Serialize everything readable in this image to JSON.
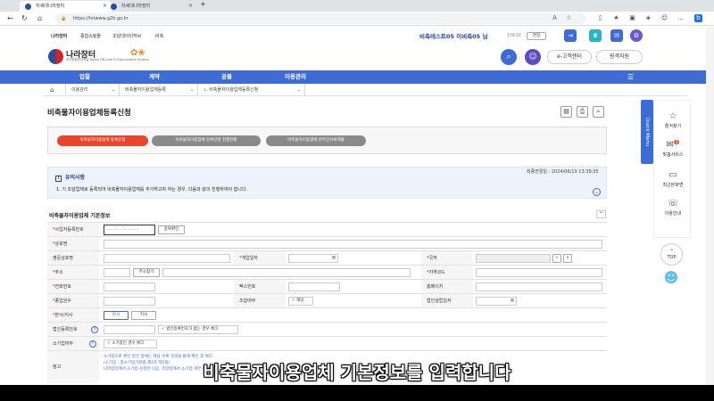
{
  "browser": {
    "tabs": [
      {
        "label": "지세대나라장터"
      },
      {
        "label": "차세대나라장터"
      }
    ],
    "url": "https://tstwww.g2b.go.kr"
  },
  "util_links": [
    "나라장터",
    "종합쇼핑몰",
    "조달데이터허브",
    "비축"
  ],
  "user": {
    "name": "비축테스트05 이비축05 님",
    "timer": "179:57",
    "extend": "연장"
  },
  "logo": {
    "text": "나라장터",
    "sub": "국가종합전자조달 Korea ON-Line E-Procurement System"
  },
  "header_buttons": {
    "customer": "e-고객센터",
    "remote": "원격지원"
  },
  "main_nav": [
    "입찰",
    "계약",
    "공통",
    "이용관리"
  ],
  "breadcrumb": [
    "이용관리",
    "비축물자이용업체등록",
    "ㄴ 비축물자이용업체등록신청"
  ],
  "page": {
    "title": "비축물자이용업체등록신청"
  },
  "steps": [
    "비축물자이용업체 등록신청",
    "비축물자이용업체 등록신청 진행현황",
    "비축물자이용업체 온라인서류제출"
  ],
  "notice": {
    "title": "유의사항",
    "text": "1. 기 조달업체로 등록되어 비축물자이용업체를 추가하고자 하는 경우, 다음과 같이 진행하여야 합니다.",
    "date": "최종변경일 : 2024/06/19 13:39:55"
  },
  "section": {
    "title": "비축물자이용업체 기본정보"
  },
  "form": {
    "biz_no": "사업자등록번호",
    "dup_check": "중복확인",
    "company": "상호명",
    "company_en": "영문상호명",
    "open_date": "개업일자",
    "country": "국적",
    "address": "주소",
    "addr_search": "주소찾기",
    "area_code": "지역코드",
    "phone": "전화번호",
    "fax": "팩스번호",
    "homepage": "홈페이지",
    "employees": "종업원수",
    "union": "조합여부",
    "union_opt": "해당",
    "corp_date": "법인설립일자",
    "hq": "본사/지사",
    "hq_opt": "본사",
    "branch_opt": "지사",
    "corp_no": "법인등록번호",
    "no_corp": "법인등록번호가 없는 경우 체크",
    "small": "소기업여부",
    "small_opt": "소기업인 경우 체크",
    "ref": "참고",
    "ref_text1": "소기업으로 확인 받은 업체는 해당 목록 검색을 통해 확인 후 체크",
    "ref_text2": "(소기업 : 중소기업기본법 제2조 제2항)",
    "ref_text3": "나라장터에서 소기업 신청한 다음, 조달청에서 소기업 여부 확인"
  },
  "side": {
    "quick": "Quick Menu",
    "items": [
      {
        "label": "즐겨찾기"
      },
      {
        "label": "맞춤서비스",
        "badge": "0"
      },
      {
        "label": "최근본화면"
      },
      {
        "label": "이용안내"
      }
    ],
    "top": "TOP"
  },
  "caption": "비축물자이용업체 기본정보를 입력합니다",
  "colors": {
    "brand": "#3e6cd6",
    "step_active": "#e8452b",
    "step_inactive": "#8a8a8a"
  }
}
